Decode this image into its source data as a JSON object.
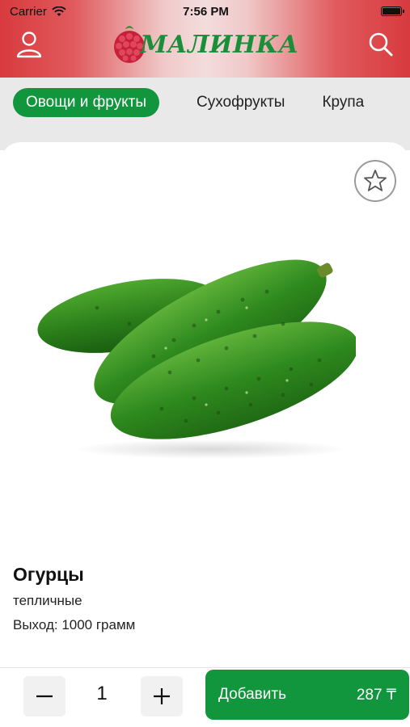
{
  "status_bar": {
    "carrier": "Carrier",
    "time": "7:56 PM"
  },
  "header": {
    "logo_text": "МАЛИНКА",
    "profile_icon": "user-icon",
    "search_icon": "search-icon"
  },
  "tabs": [
    {
      "label": "Овощи и фрукты",
      "active": true
    },
    {
      "label": "Сухофрукты",
      "active": false
    },
    {
      "label": "Крупа",
      "active": false
    }
  ],
  "product": {
    "title": "Огурцы",
    "subtitle": "тепличные",
    "yield": "Выход: 1000 грамм",
    "favorite_icon": "star-icon"
  },
  "cart": {
    "minus": "minus-icon",
    "quantity": "1",
    "plus": "plus-icon",
    "add_label": "Добавить",
    "price": "287 ₸"
  },
  "colors": {
    "accent": "#12963d",
    "header_red": "#d83a3e"
  }
}
